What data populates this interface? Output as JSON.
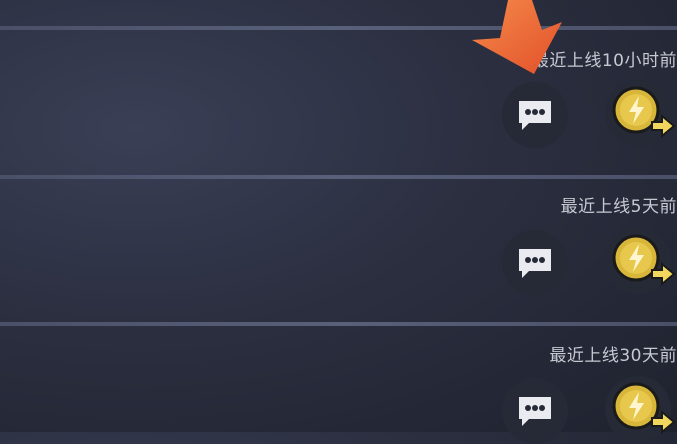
{
  "rows": [
    {
      "status_text": "最近上线10小时前"
    },
    {
      "status_text": "最近上线5天前"
    },
    {
      "status_text": "最近上线30天前"
    }
  ],
  "icons": {
    "chat": "chat-bubble-icon",
    "coin": "lightning-coin-icon",
    "pointer": "orange-arrow-pointer-icon"
  },
  "colors": {
    "background": "#2b2f40",
    "divider": "#525872",
    "status_text": "#c7c9d2",
    "coin_gold": "#d8b63a",
    "arrow_orange": "#f26b3a"
  }
}
